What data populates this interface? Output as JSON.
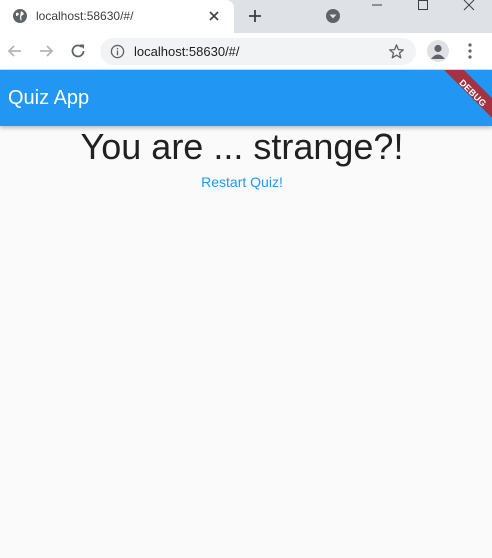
{
  "browser": {
    "tab": {
      "title": "localhost:58630/#/"
    },
    "omnibox": {
      "url": "localhost:58630/#/"
    }
  },
  "app": {
    "title": "Quiz App",
    "debug_label": "DEBUG",
    "result_text": "You are ... strange?!",
    "restart_label": "Restart Quiz!"
  },
  "colors": {
    "app_bar": "#2196f3",
    "debug_banner": "#a33243",
    "restart_text": "#2196f3"
  },
  "icons": [
    "globe-icon",
    "close-icon",
    "plus-icon",
    "tab-search-icon",
    "minimize-icon",
    "maximize-icon",
    "window-close-icon",
    "back-arrow-icon",
    "forward-arrow-icon",
    "reload-icon",
    "info-icon",
    "star-icon",
    "profile-icon",
    "kebab-menu-icon"
  ]
}
